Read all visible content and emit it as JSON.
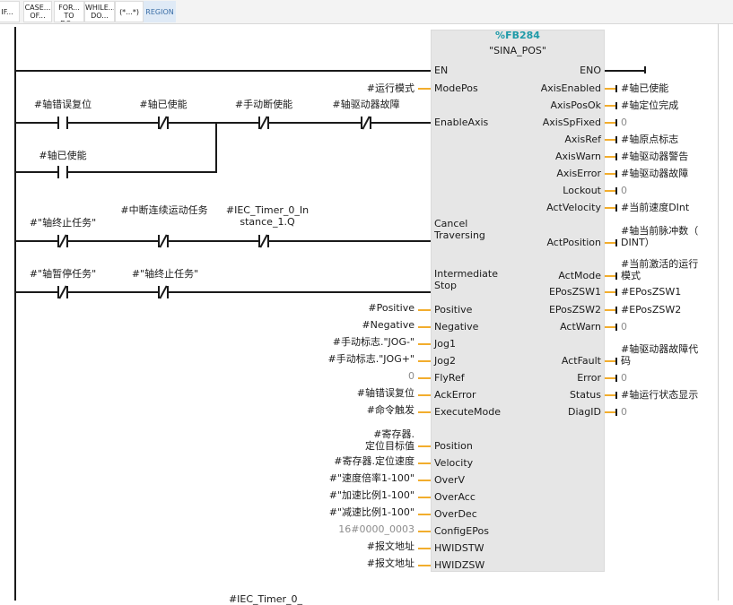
{
  "toolbar": {
    "items": [
      "IF...",
      "CASE...\nOF...",
      "FOR...\nTO DO...",
      "WHILE...\nDO...",
      "(*...*)",
      "REGION"
    ]
  },
  "rungs": {
    "r1": {
      "c1": "#轴错误复位",
      "c2": "#轴已使能",
      "c3": "#手动断使能",
      "c4": "#轴驱动器故障",
      "c5": "#轴已使能"
    },
    "r2": {
      "c1": "#\"轴终止任务\"",
      "c2": "#中断连续运动任务",
      "c3": "#IEC_Timer_0_Instance_1.Q"
    },
    "r3": {
      "c1": "#\"轴暂停任务\"",
      "c2": "#\"轴终止任务\""
    },
    "bottom": {
      "c1": "#IEC_Timer_0_"
    }
  },
  "block": {
    "db": "%FB284",
    "name": "\"SINA_POS\""
  },
  "inputs": [
    {
      "pin": "EN",
      "actual": ""
    },
    {
      "pin": "ModePos",
      "actual": "#运行模式"
    },
    {
      "pin": "EnableAxis",
      "actual": ""
    },
    {
      "pin": "Cancel\nTraversing",
      "actual": ""
    },
    {
      "pin": "Intermediate\nStop",
      "actual": ""
    },
    {
      "pin": "Positive",
      "actual": "#Positive"
    },
    {
      "pin": "Negative",
      "actual": "#Negative"
    },
    {
      "pin": "Jog1",
      "actual": "#手动标志.\"JOG-\""
    },
    {
      "pin": "Jog2",
      "actual": "#手动标志.\"JOG+\""
    },
    {
      "pin": "FlyRef",
      "actual": "0"
    },
    {
      "pin": "AckError",
      "actual": "#轴错误复位"
    },
    {
      "pin": "ExecuteMode",
      "actual": "#命令触发"
    },
    {
      "pin": "Position",
      "actual": "#寄存器.\n定位目标值"
    },
    {
      "pin": "Velocity",
      "actual": "#寄存器.定位速度"
    },
    {
      "pin": "OverV",
      "actual": "#\"速度倍率1-100\""
    },
    {
      "pin": "OverAcc",
      "actual": "#\"加速比例1-100\""
    },
    {
      "pin": "OverDec",
      "actual": "#\"减速比例1-100\""
    },
    {
      "pin": "ConfigEPos",
      "actual": "16#0000_0003"
    },
    {
      "pin": "HWIDSTW",
      "actual": "#报文地址"
    },
    {
      "pin": "HWIDZSW",
      "actual": "#报文地址"
    }
  ],
  "outputs": [
    {
      "pin": "ENO",
      "actual": ""
    },
    {
      "pin": "AxisEnabled",
      "actual": "#轴已使能"
    },
    {
      "pin": "AxisPosOk",
      "actual": "#轴定位完成"
    },
    {
      "pin": "AxisSpFixed",
      "actual": "0"
    },
    {
      "pin": "AxisRef",
      "actual": "#轴原点标志"
    },
    {
      "pin": "AxisWarn",
      "actual": "#轴驱动器警告"
    },
    {
      "pin": "AxisError",
      "actual": "#轴驱动器故障"
    },
    {
      "pin": "Lockout",
      "actual": "0"
    },
    {
      "pin": "ActVelocity",
      "actual": "#当前速度DInt"
    },
    {
      "pin": "ActPosition",
      "actual": "#轴当前脉冲数（\nDINT）"
    },
    {
      "pin": "ActMode",
      "actual": "#当前激活的运行\n模式"
    },
    {
      "pin": "EPosZSW1",
      "actual": "#EPosZSW1"
    },
    {
      "pin": "EPosZSW2",
      "actual": "#EPosZSW2"
    },
    {
      "pin": "ActWarn",
      "actual": "0"
    },
    {
      "pin": "ActFault",
      "actual": "#轴驱动器故障代\n码"
    },
    {
      "pin": "Error",
      "actual": "0"
    },
    {
      "pin": "Status",
      "actual": "#轴运行状态显示"
    },
    {
      "pin": "DiagID",
      "actual": "0"
    }
  ]
}
